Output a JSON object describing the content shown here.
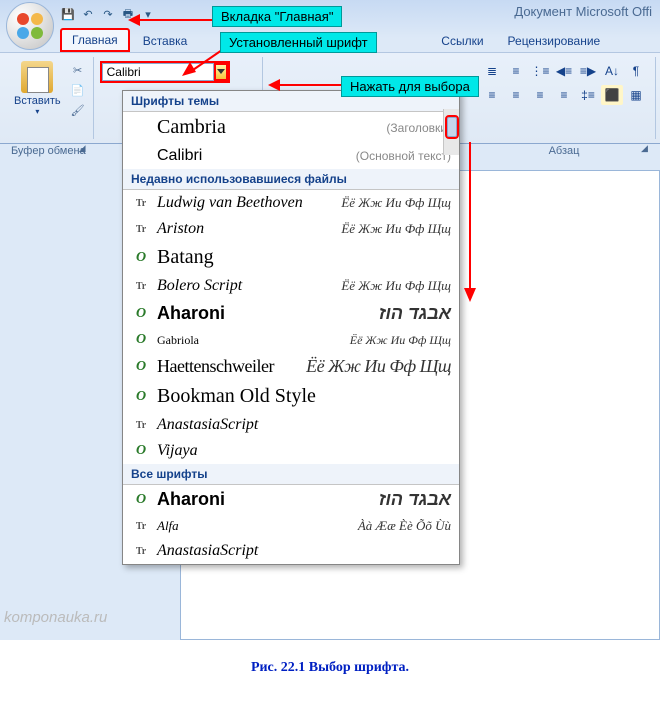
{
  "titlebar": {
    "doc_title": "Документ Microsoft Offi"
  },
  "tabs": {
    "home": "Главная",
    "insert": "Вставка",
    "links": "Ссылки",
    "review": "Рецензирование"
  },
  "ribbon": {
    "clipboard": {
      "paste_label": "Вставить",
      "group_label": "Буфер обмена"
    },
    "font_input_value": "Calibri",
    "paragraph_group_label": "Абзац"
  },
  "callouts": {
    "c1": "Вкладка \"Главная\"",
    "c2": "Установленный шрифт",
    "c3": "Нажать для выбора"
  },
  "font_dropdown": {
    "h_theme": "Шрифты темы",
    "h_recent": "Недавно использовавшиеся файлы",
    "h_all": "Все шрифты",
    "theme": [
      {
        "name": "Cambria",
        "hint": "(Заголовки)"
      },
      {
        "name": "Calibri",
        "hint": "(Основной текст)"
      }
    ],
    "recent": [
      {
        "icon": "tt",
        "name": "Ludwig van Beethoven",
        "font": "cursive",
        "sample": "Ёё Жж Ии Фф Щщ"
      },
      {
        "icon": "tt",
        "name": "Ariston",
        "font": "cursive",
        "sample": "Ёё Жж Ии Фф Щщ"
      },
      {
        "icon": "ot",
        "name": "Batang",
        "font": "serif",
        "sample": ""
      },
      {
        "icon": "tt",
        "name": "Bolero Script",
        "font": "cursive",
        "sample": "Ёё Жж Ии Фф Щщ"
      },
      {
        "icon": "ot",
        "name": "Aharoni",
        "font": "sans-bold",
        "sample": "אבגד הוז"
      },
      {
        "icon": "ot",
        "name": "Gabriola",
        "font": "script-sm",
        "sample": "Ёё Жж Ии Фф Щщ"
      },
      {
        "icon": "ot",
        "name": "Haettenschweiler",
        "font": "cond-bold",
        "sample": "Ёё Жж Ии Фф Щщ"
      },
      {
        "icon": "ot",
        "name": "Bookman Old Style",
        "font": "bookman",
        "sample": ""
      },
      {
        "icon": "tt",
        "name": "AnastasiaScript",
        "font": "cursive",
        "sample": ""
      },
      {
        "icon": "ot",
        "name": "Vijaya",
        "font": "serif-it",
        "sample": ""
      }
    ],
    "all": [
      {
        "icon": "ot",
        "name": "Aharoni",
        "font": "sans-bold",
        "sample": "אבגד הוז"
      },
      {
        "icon": "tt",
        "name": "Alfa",
        "font": "cursive-sm",
        "sample": "Àà Ææ Èè Õõ Ùù"
      },
      {
        "icon": "tt",
        "name": "AnastasiaScript",
        "font": "cursive",
        "sample": ""
      }
    ]
  },
  "watermark": "komponauka.ru",
  "caption": "Рис. 22.1 Выбор шрифта."
}
